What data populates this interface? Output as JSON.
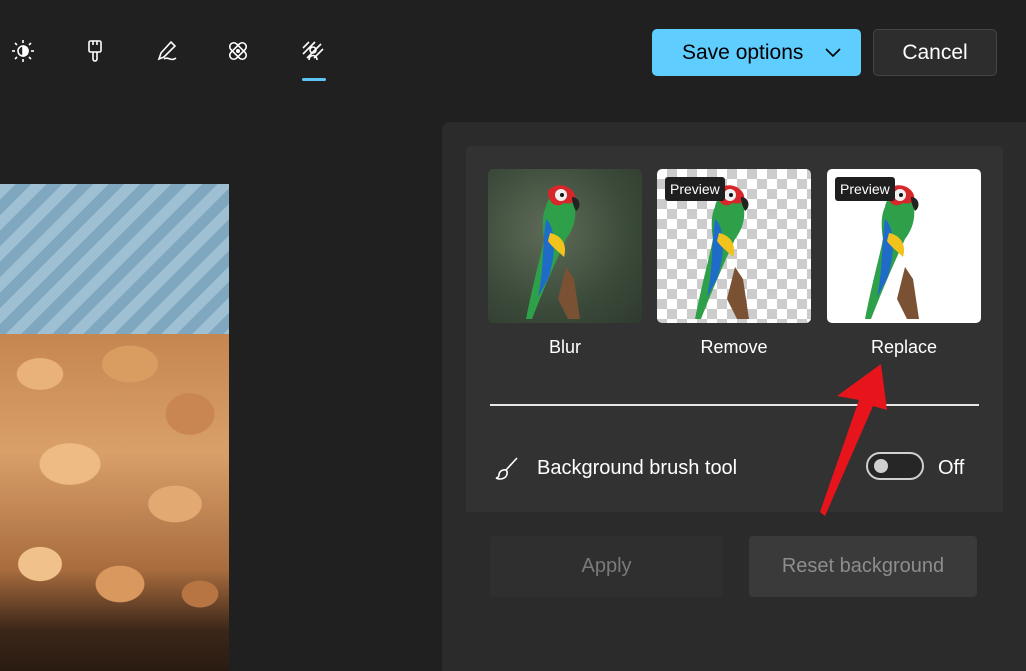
{
  "toolbar": {
    "tools": [
      {
        "name": "adjustment-icon",
        "active": false
      },
      {
        "name": "filter-brush-icon",
        "active": false
      },
      {
        "name": "markup-pen-icon",
        "active": false
      },
      {
        "name": "retouch-icon",
        "active": false
      },
      {
        "name": "background-icon",
        "active": true
      }
    ],
    "save_label": "Save options",
    "cancel_label": "Cancel",
    "accent_color": "#60cdff"
  },
  "background_panel": {
    "options": [
      {
        "label": "Blur",
        "badge": ""
      },
      {
        "label": "Remove",
        "badge": "Preview"
      },
      {
        "label": "Replace",
        "badge": "Preview"
      }
    ],
    "brush_tool": {
      "label": "Background brush tool",
      "toggle_state": "Off"
    },
    "apply_label": "Apply",
    "reset_label": "Reset background"
  },
  "annotation": {
    "arrow_color": "#e8141c"
  }
}
